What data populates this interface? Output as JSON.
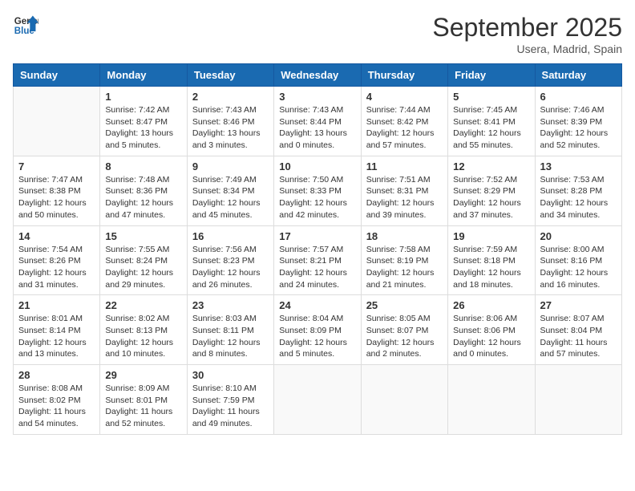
{
  "header": {
    "logo_general": "General",
    "logo_blue": "Blue",
    "month": "September 2025",
    "location": "Usera, Madrid, Spain"
  },
  "days_of_week": [
    "Sunday",
    "Monday",
    "Tuesday",
    "Wednesday",
    "Thursday",
    "Friday",
    "Saturday"
  ],
  "weeks": [
    [
      {
        "num": "",
        "info": ""
      },
      {
        "num": "1",
        "info": "Sunrise: 7:42 AM\nSunset: 8:47 PM\nDaylight: 13 hours\nand 5 minutes."
      },
      {
        "num": "2",
        "info": "Sunrise: 7:43 AM\nSunset: 8:46 PM\nDaylight: 13 hours\nand 3 minutes."
      },
      {
        "num": "3",
        "info": "Sunrise: 7:43 AM\nSunset: 8:44 PM\nDaylight: 13 hours\nand 0 minutes."
      },
      {
        "num": "4",
        "info": "Sunrise: 7:44 AM\nSunset: 8:42 PM\nDaylight: 12 hours\nand 57 minutes."
      },
      {
        "num": "5",
        "info": "Sunrise: 7:45 AM\nSunset: 8:41 PM\nDaylight: 12 hours\nand 55 minutes."
      },
      {
        "num": "6",
        "info": "Sunrise: 7:46 AM\nSunset: 8:39 PM\nDaylight: 12 hours\nand 52 minutes."
      }
    ],
    [
      {
        "num": "7",
        "info": "Sunrise: 7:47 AM\nSunset: 8:38 PM\nDaylight: 12 hours\nand 50 minutes."
      },
      {
        "num": "8",
        "info": "Sunrise: 7:48 AM\nSunset: 8:36 PM\nDaylight: 12 hours\nand 47 minutes."
      },
      {
        "num": "9",
        "info": "Sunrise: 7:49 AM\nSunset: 8:34 PM\nDaylight: 12 hours\nand 45 minutes."
      },
      {
        "num": "10",
        "info": "Sunrise: 7:50 AM\nSunset: 8:33 PM\nDaylight: 12 hours\nand 42 minutes."
      },
      {
        "num": "11",
        "info": "Sunrise: 7:51 AM\nSunset: 8:31 PM\nDaylight: 12 hours\nand 39 minutes."
      },
      {
        "num": "12",
        "info": "Sunrise: 7:52 AM\nSunset: 8:29 PM\nDaylight: 12 hours\nand 37 minutes."
      },
      {
        "num": "13",
        "info": "Sunrise: 7:53 AM\nSunset: 8:28 PM\nDaylight: 12 hours\nand 34 minutes."
      }
    ],
    [
      {
        "num": "14",
        "info": "Sunrise: 7:54 AM\nSunset: 8:26 PM\nDaylight: 12 hours\nand 31 minutes."
      },
      {
        "num": "15",
        "info": "Sunrise: 7:55 AM\nSunset: 8:24 PM\nDaylight: 12 hours\nand 29 minutes."
      },
      {
        "num": "16",
        "info": "Sunrise: 7:56 AM\nSunset: 8:23 PM\nDaylight: 12 hours\nand 26 minutes."
      },
      {
        "num": "17",
        "info": "Sunrise: 7:57 AM\nSunset: 8:21 PM\nDaylight: 12 hours\nand 24 minutes."
      },
      {
        "num": "18",
        "info": "Sunrise: 7:58 AM\nSunset: 8:19 PM\nDaylight: 12 hours\nand 21 minutes."
      },
      {
        "num": "19",
        "info": "Sunrise: 7:59 AM\nSunset: 8:18 PM\nDaylight: 12 hours\nand 18 minutes."
      },
      {
        "num": "20",
        "info": "Sunrise: 8:00 AM\nSunset: 8:16 PM\nDaylight: 12 hours\nand 16 minutes."
      }
    ],
    [
      {
        "num": "21",
        "info": "Sunrise: 8:01 AM\nSunset: 8:14 PM\nDaylight: 12 hours\nand 13 minutes."
      },
      {
        "num": "22",
        "info": "Sunrise: 8:02 AM\nSunset: 8:13 PM\nDaylight: 12 hours\nand 10 minutes."
      },
      {
        "num": "23",
        "info": "Sunrise: 8:03 AM\nSunset: 8:11 PM\nDaylight: 12 hours\nand 8 minutes."
      },
      {
        "num": "24",
        "info": "Sunrise: 8:04 AM\nSunset: 8:09 PM\nDaylight: 12 hours\nand 5 minutes."
      },
      {
        "num": "25",
        "info": "Sunrise: 8:05 AM\nSunset: 8:07 PM\nDaylight: 12 hours\nand 2 minutes."
      },
      {
        "num": "26",
        "info": "Sunrise: 8:06 AM\nSunset: 8:06 PM\nDaylight: 12 hours\nand 0 minutes."
      },
      {
        "num": "27",
        "info": "Sunrise: 8:07 AM\nSunset: 8:04 PM\nDaylight: 11 hours\nand 57 minutes."
      }
    ],
    [
      {
        "num": "28",
        "info": "Sunrise: 8:08 AM\nSunset: 8:02 PM\nDaylight: 11 hours\nand 54 minutes."
      },
      {
        "num": "29",
        "info": "Sunrise: 8:09 AM\nSunset: 8:01 PM\nDaylight: 11 hours\nand 52 minutes."
      },
      {
        "num": "30",
        "info": "Sunrise: 8:10 AM\nSunset: 7:59 PM\nDaylight: 11 hours\nand 49 minutes."
      },
      {
        "num": "",
        "info": ""
      },
      {
        "num": "",
        "info": ""
      },
      {
        "num": "",
        "info": ""
      },
      {
        "num": "",
        "info": ""
      }
    ]
  ]
}
